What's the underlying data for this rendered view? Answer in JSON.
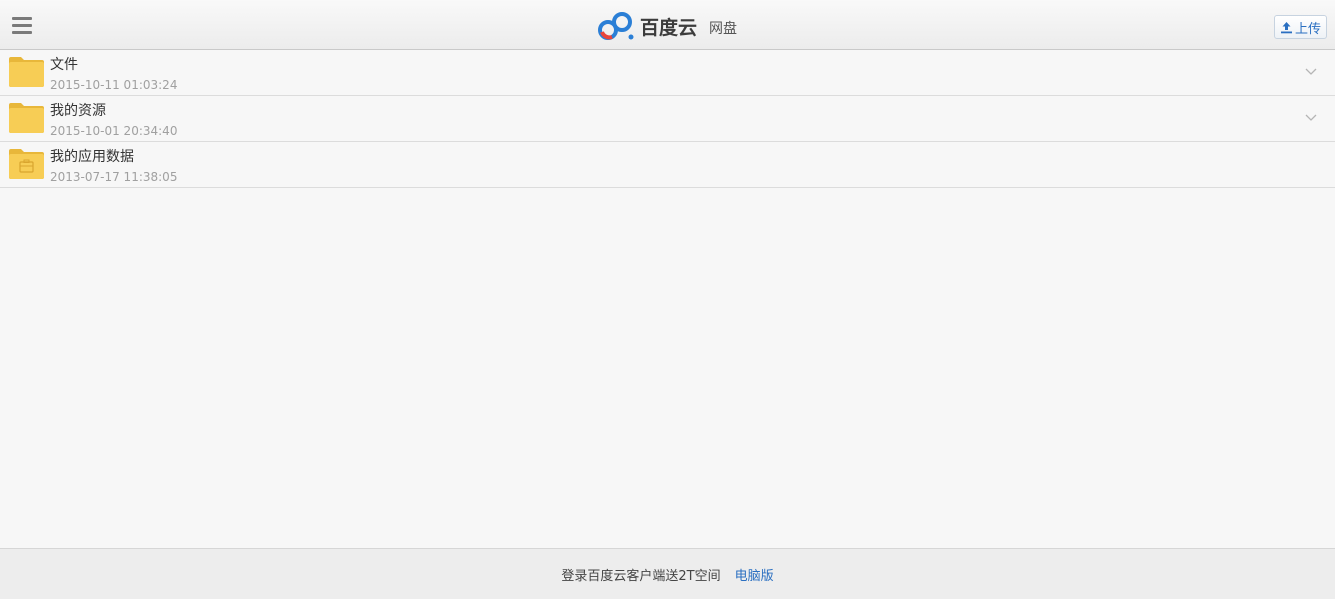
{
  "header": {
    "menu_icon": "hamburger-menu-icon",
    "brand_name": "百度云",
    "brand_sub": "网盘",
    "upload_label": "上传",
    "upload_icon": "upload-icon",
    "brand_colors": [
      "#2b7fd6",
      "#e8453c",
      "#3c3c3c"
    ]
  },
  "files": [
    {
      "name": "文件",
      "date": "2015-10-11 01:03:24",
      "icon": "folder-icon",
      "expandable": true
    },
    {
      "name": "我的资源",
      "date": "2015-10-01 20:34:40",
      "icon": "folder-icon",
      "expandable": true
    },
    {
      "name": "我的应用数据",
      "date": "2013-07-17 11:38:05",
      "icon": "app-data-folder-icon",
      "expandable": false
    }
  ],
  "footer": {
    "promo_text": "登录百度云客户端送2T空间",
    "pc_link": "电脑版"
  },
  "colors": {
    "accent": "#2a6fc1",
    "folder": "#f5c84c",
    "background": "#f7f7f7"
  }
}
